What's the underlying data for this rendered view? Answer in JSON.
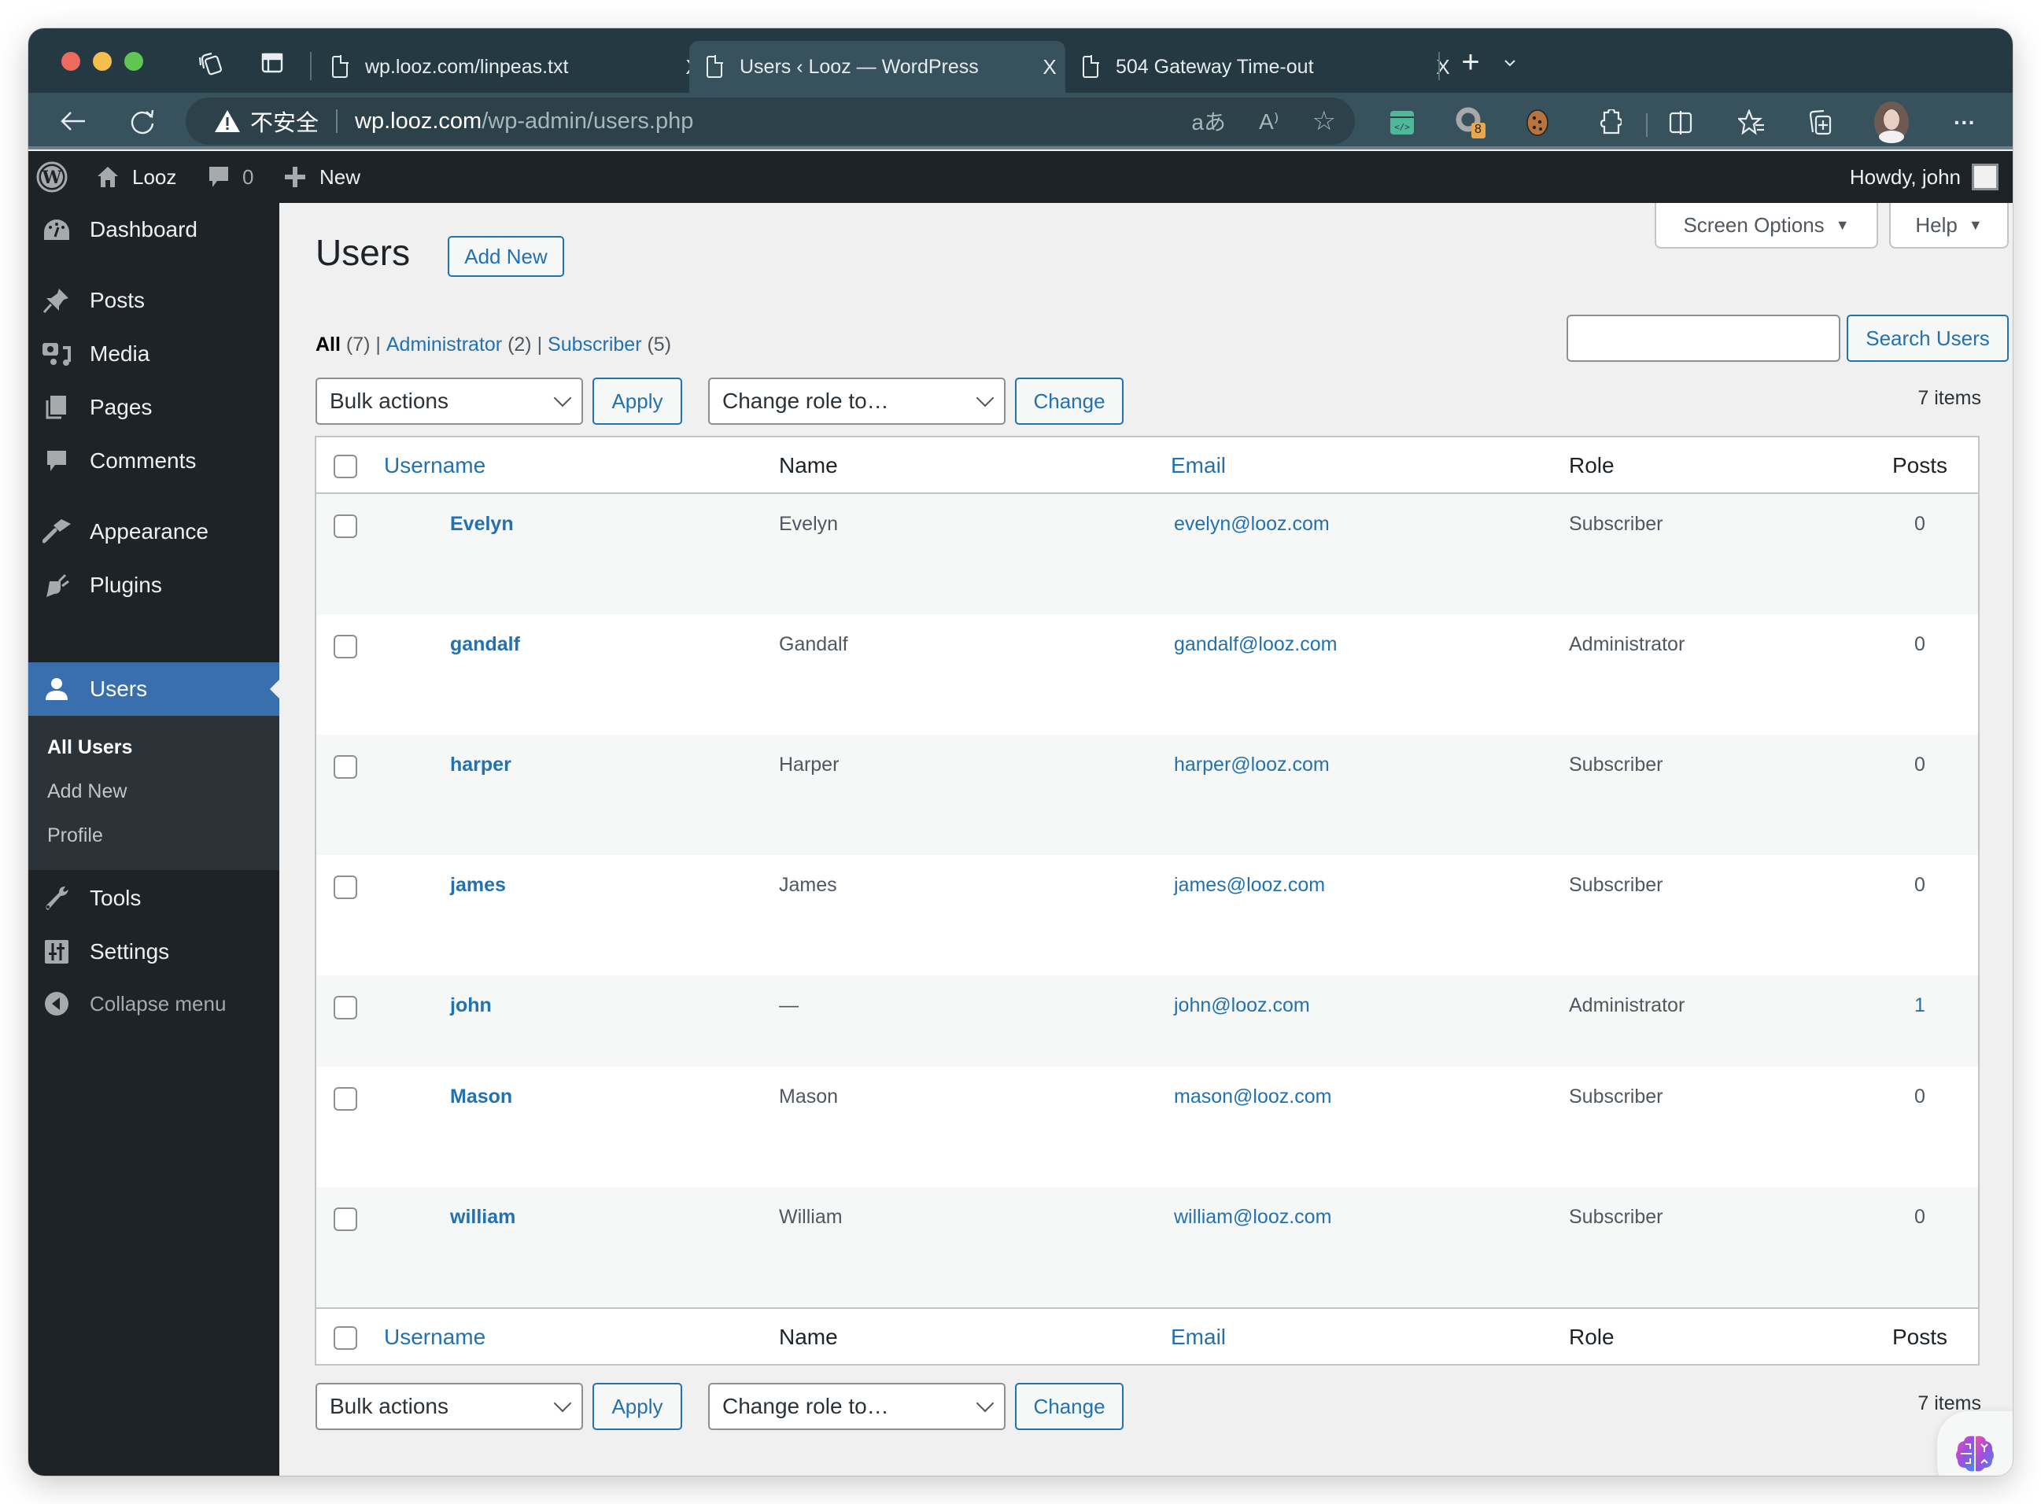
{
  "browser": {
    "tabs": [
      {
        "title": "wp.looz.com/linpeas.txt",
        "active": false
      },
      {
        "title": "Users ‹ Looz — WordPress",
        "active": true
      },
      {
        "title": "504 Gateway Time-out",
        "active": false
      }
    ],
    "close_glyph": "X",
    "new_tab_glyph": "+",
    "tab_list_glyph": "⌄",
    "security_label": "不安全",
    "url_host": "wp.looz.com",
    "url_path": "/wp-admin/users.php",
    "address_icons": {
      "translate": "aあ",
      "read_aloud": "A⁾",
      "favorite": "☆"
    },
    "extension_badge": "8",
    "more_glyph": "···"
  },
  "adminbar": {
    "site_name": "Looz",
    "comments_count": "0",
    "new_label": "New",
    "howdy": "Howdy, john"
  },
  "sidebar": {
    "items": [
      {
        "label": "Dashboard",
        "icon": "dashboard-icon"
      },
      {
        "label": "Posts",
        "icon": "pin-icon"
      },
      {
        "label": "Media",
        "icon": "media-icon"
      },
      {
        "label": "Pages",
        "icon": "pages-icon"
      },
      {
        "label": "Comments",
        "icon": "comment-icon"
      },
      {
        "label": "Appearance",
        "icon": "brush-icon"
      },
      {
        "label": "Plugins",
        "icon": "plug-icon"
      },
      {
        "label": "Users",
        "icon": "user-icon",
        "current": true
      },
      {
        "label": "Tools",
        "icon": "wrench-icon"
      },
      {
        "label": "Settings",
        "icon": "settings-icon"
      }
    ],
    "users_submenu": [
      "All Users",
      "Add New",
      "Profile"
    ],
    "collapse_label": "Collapse menu"
  },
  "screen_meta": {
    "screen_options": "Screen Options",
    "help": "Help",
    "arrow": "▼"
  },
  "page": {
    "title": "Users",
    "add_new": "Add New",
    "views": [
      {
        "label": "All",
        "count": "(7)",
        "current": true
      },
      {
        "label": "Administrator",
        "count": "(2)",
        "current": false
      },
      {
        "label": "Subscriber",
        "count": "(5)",
        "current": false
      }
    ],
    "view_separator": " | ",
    "search": {
      "value": "",
      "button": "Search Users"
    },
    "bulk_actions": "Bulk actions",
    "apply": "Apply",
    "change_role": "Change role to…",
    "change": "Change",
    "items_count": "7 items"
  },
  "table": {
    "columns": {
      "username": "Username",
      "name": "Name",
      "email": "Email",
      "role": "Role",
      "posts": "Posts"
    },
    "rows": [
      {
        "username": "Evelyn",
        "name": "Evelyn",
        "email": "evelyn@looz.com",
        "role": "Subscriber",
        "posts": "0"
      },
      {
        "username": "gandalf",
        "name": "Gandalf",
        "email": "gandalf@looz.com",
        "role": "Administrator",
        "posts": "0"
      },
      {
        "username": "harper",
        "name": "Harper",
        "email": "harper@looz.com",
        "role": "Subscriber",
        "posts": "0"
      },
      {
        "username": "james",
        "name": "James",
        "email": "james@looz.com",
        "role": "Subscriber",
        "posts": "0"
      },
      {
        "username": "john",
        "name": "—",
        "email": "john@looz.com",
        "role": "Administrator",
        "posts": "1"
      },
      {
        "username": "Mason",
        "name": "Mason",
        "email": "mason@looz.com",
        "role": "Subscriber",
        "posts": "0"
      },
      {
        "username": "william",
        "name": "William",
        "email": "william@looz.com",
        "role": "Subscriber",
        "posts": "0"
      }
    ]
  },
  "colors": {
    "accent": "#2271b1",
    "adminbar": "#1d2327",
    "menu_current": "#3a6fae",
    "content_bg": "#f0f0f1"
  }
}
